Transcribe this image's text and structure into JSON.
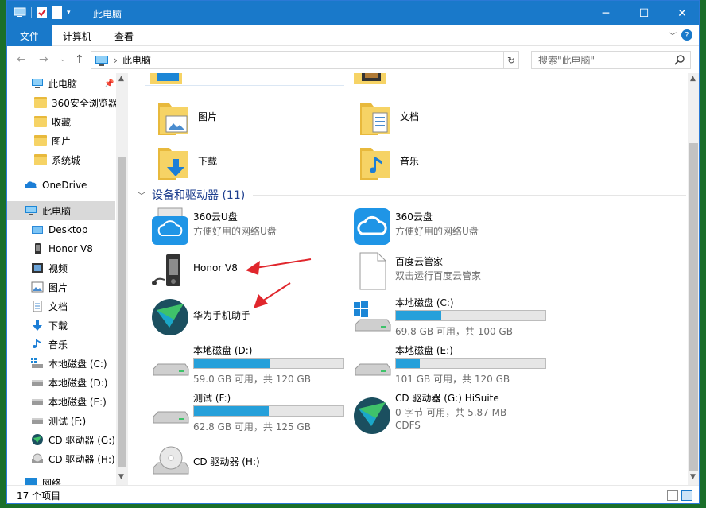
{
  "window": {
    "title": "此电脑",
    "controls": {
      "minimize": "─",
      "maximize": "☐",
      "close": "✕"
    }
  },
  "ribbon": {
    "file": "文件",
    "tabs": [
      "计算机",
      "查看"
    ]
  },
  "address": {
    "path": "此电脑",
    "search_placeholder": "搜索\"此电脑\""
  },
  "sidebar": {
    "items": [
      {
        "label": "此电脑",
        "icon": "pc-icon"
      },
      {
        "label": "360安全浏览器",
        "icon": "folder-icon"
      },
      {
        "label": "收藏",
        "icon": "folder-icon"
      },
      {
        "label": "图片",
        "icon": "folder-icon"
      },
      {
        "label": "系统城",
        "icon": "folder-icon"
      },
      {
        "label": "OneDrive",
        "icon": "onedrive-icon"
      },
      {
        "label": "此电脑",
        "icon": "pc-icon"
      },
      {
        "label": "Desktop",
        "icon": "desktop-icon"
      },
      {
        "label": "Honor V8",
        "icon": "phone-icon"
      },
      {
        "label": "视频",
        "icon": "video-icon"
      },
      {
        "label": "图片",
        "icon": "pictures-icon"
      },
      {
        "label": "文档",
        "icon": "documents-icon"
      },
      {
        "label": "下载",
        "icon": "download-icon"
      },
      {
        "label": "音乐",
        "icon": "music-icon"
      },
      {
        "label": "本地磁盘 (C:)",
        "icon": "drive-c-icon"
      },
      {
        "label": "本地磁盘 (D:)",
        "icon": "drive-icon"
      },
      {
        "label": "本地磁盘 (E:)",
        "icon": "drive-icon"
      },
      {
        "label": "测试 (F:)",
        "icon": "drive-icon"
      },
      {
        "label": "CD 驱动器 (G:)",
        "icon": "hisuite-icon"
      },
      {
        "label": "CD 驱动器 (H:)",
        "icon": "cd-icon"
      },
      {
        "label": "网络",
        "icon": "network-icon"
      }
    ]
  },
  "folders": [
    {
      "label": "图片"
    },
    {
      "label": "文档"
    },
    {
      "label": "下载"
    },
    {
      "label": "音乐"
    }
  ],
  "devices_group": {
    "title": "设备和驱动器 (11)"
  },
  "devices": [
    {
      "name": "360云U盘",
      "sub": "方便好用的网络U盘"
    },
    {
      "name": "360云盘",
      "sub": "方便好用的网络U盘"
    },
    {
      "name": "Honor V8",
      "sub": ""
    },
    {
      "name": "百度云管家",
      "sub": "双击运行百度云管家"
    },
    {
      "name": "华为手机助手",
      "sub": ""
    },
    {
      "name": "本地磁盘 (C:)",
      "free": "69.8 GB 可用，共 100 GB",
      "used_fraction": 0.302
    },
    {
      "name": "本地磁盘 (D:)",
      "free": "59.0 GB 可用，共 120 GB",
      "used_fraction": 0.508
    },
    {
      "name": "本地磁盘 (E:)",
      "free": "101 GB 可用，共 120 GB",
      "used_fraction": 0.158
    },
    {
      "name": "测试 (F:)",
      "free": "62.8 GB 可用，共 125 GB",
      "used_fraction": 0.498
    },
    {
      "name": "CD 驱动器 (G:) HiSuite",
      "sub": "0 字节 可用，共 5.87 MB",
      "sub2": "CDFS"
    },
    {
      "name": "CD 驱动器 (H:)",
      "sub": ""
    }
  ],
  "status": {
    "count": "17 个项目"
  },
  "colors": {
    "accent": "#1979ca",
    "bar_fill": "#26a0da",
    "arrow": "#e0262c"
  }
}
